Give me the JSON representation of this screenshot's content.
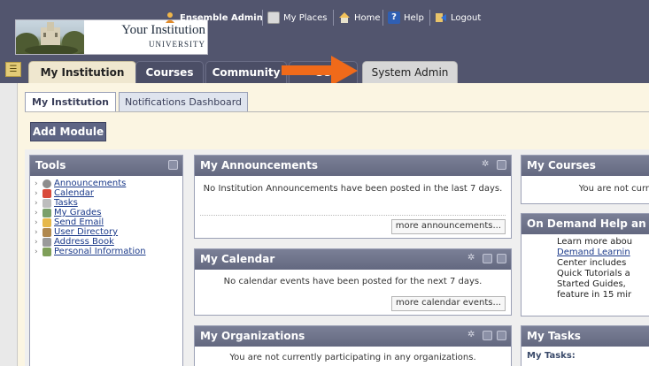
{
  "header": {
    "logo_name": "Your Institution",
    "logo_sub": "UNIVERSITY",
    "top_links": [
      "Ensemble Admin",
      "My Places",
      "Home",
      "Help",
      "Logout"
    ]
  },
  "tabs": [
    "My Institution",
    "Courses",
    "Community",
    "Se",
    "System Admin"
  ],
  "subtabs": [
    "My Institution",
    "Notifications Dashboard"
  ],
  "add_module": "Add Module",
  "tools": {
    "title": "Tools",
    "items": [
      "Announcements",
      "Calendar",
      "Tasks",
      "My Grades",
      "Send Email",
      "User Directory",
      "Address Book",
      "Personal Information"
    ]
  },
  "announcements": {
    "title": "My Announcements",
    "body": "No Institution Announcements have been posted in the last 7 days.",
    "more": "more announcements..."
  },
  "calendar": {
    "title": "My Calendar",
    "body": "No calendar events have been posted for the next 7 days.",
    "more": "more calendar events..."
  },
  "organizations": {
    "title": "My Organizations",
    "body": "You are not currently participating in any organizations."
  },
  "courses": {
    "title": "My Courses",
    "body": "You are not curr"
  },
  "ondemand": {
    "title": "On Demand Help an",
    "line1": "Learn more abou",
    "link": "Demand Learnin",
    "line2": "Center includes",
    "line3": "Quick Tutorials a",
    "line4": "Started Guides,",
    "line5": "feature in 15 mir"
  },
  "tasks": {
    "title": "My Tasks",
    "sub": "My Tasks:"
  },
  "colors": {
    "header_bg": "#52556e",
    "module_head": "#6a6f87",
    "arrow": "#f06a1a",
    "link": "#1b3a8a"
  }
}
